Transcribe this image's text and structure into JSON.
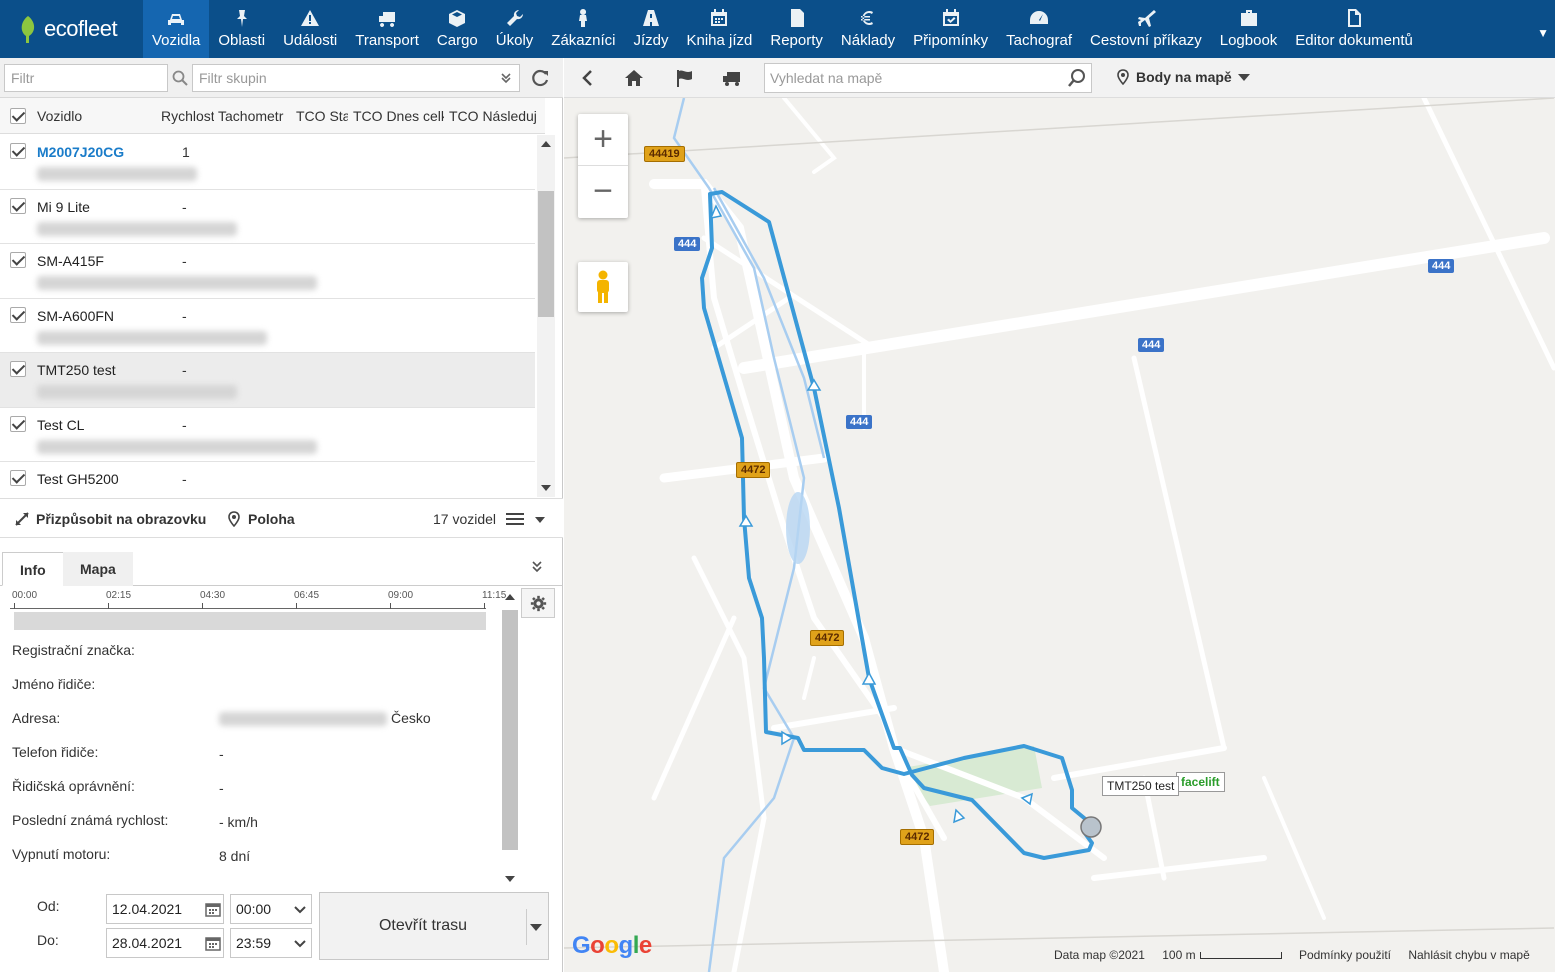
{
  "app": {
    "logo": "ecofleet"
  },
  "nav": [
    {
      "label": "Vozidla",
      "icon": "car-icon",
      "active": true
    },
    {
      "label": "Oblasti",
      "icon": "pin-icon"
    },
    {
      "label": "Události",
      "icon": "warning-icon"
    },
    {
      "label": "Transport",
      "icon": "truck-icon"
    },
    {
      "label": "Cargo",
      "icon": "box-icon"
    },
    {
      "label": "Úkoly",
      "icon": "wrench-icon"
    },
    {
      "label": "Zákazníci",
      "icon": "person-icon"
    },
    {
      "label": "Jízdy",
      "icon": "road-icon"
    },
    {
      "label": "Kniha jízd",
      "icon": "calendar-icon"
    },
    {
      "label": "Reporty",
      "icon": "document-icon"
    },
    {
      "label": "Náklady",
      "icon": "euro-icon"
    },
    {
      "label": "Připomínky",
      "icon": "calendar-check-icon"
    },
    {
      "label": "Tachograf",
      "icon": "gauge-icon"
    },
    {
      "label": "Cestovní příkazy",
      "icon": "plane-icon"
    },
    {
      "label": "Logbook",
      "icon": "briefcase-icon"
    },
    {
      "label": "Editor dokumentů",
      "icon": "file-icon"
    }
  ],
  "filters": {
    "filter_placeholder": "Filtr",
    "group_placeholder": "Filtr skupin"
  },
  "table": {
    "headers": [
      "Vozidlo",
      "Rychlost",
      "Tachometr",
      "TCO Stav",
      "TCO Dnes celk",
      "TCO Následující"
    ],
    "rows": [
      {
        "name": "M2007J20CG",
        "speed": "1",
        "link": true
      },
      {
        "name": "Mi 9 Lite",
        "speed": "-"
      },
      {
        "name": "SM-A415F",
        "speed": "-"
      },
      {
        "name": "SM-A600FN",
        "speed": "-"
      },
      {
        "name": "TMT250 test",
        "speed": "-",
        "selected": true
      },
      {
        "name": "Test CL",
        "speed": "-"
      },
      {
        "name": "Test GH5200",
        "speed": "-"
      }
    ]
  },
  "fitbar": {
    "fit_label": "Přizpůsobit na obrazovku",
    "position_label": "Poloha",
    "count_label": "17 vozidel"
  },
  "tabs": [
    {
      "label": "Info",
      "active": true
    },
    {
      "label": "Mapa"
    }
  ],
  "timeline": [
    "00:00",
    "02:15",
    "04:30",
    "06:45",
    "09:00",
    "11:15"
  ],
  "info": {
    "reg_label": "Registrační značka:",
    "driver_label": "Jméno řidiče:",
    "address_label": "Adresa:",
    "address_value": "Česko",
    "phone_label": "Telefon řidiče:",
    "phone_value": "-",
    "license_label": "Řidičská oprávnění:",
    "license_value": "-",
    "speed_label": "Poslední známá rychlost:",
    "speed_value": "- km/h",
    "engine_label": "Vypnutí motoru:",
    "engine_value": "8 dní"
  },
  "dates": {
    "from_label": "Od:",
    "from_date": "12.04.2021",
    "from_time": "00:00",
    "to_label": "Do:",
    "to_date": "28.04.2021",
    "to_time": "23:59",
    "open_route": "Otevřít trasu"
  },
  "map": {
    "search_placeholder": "Vyhledat na mapě",
    "points_label": "Body na mapě",
    "vehicle_label": "TMT250 test",
    "vehicle_label_2": "facelift",
    "roads": [
      "44419",
      "444",
      "444",
      "444",
      "444",
      "4472",
      "4472",
      "4472"
    ],
    "copyright": "Data map ©2021",
    "scale": "100 m",
    "terms": "Podmínky použití",
    "report": "Nahlásit chybu v mapě",
    "google": "Google",
    "route_color": "#3a9ad9"
  }
}
